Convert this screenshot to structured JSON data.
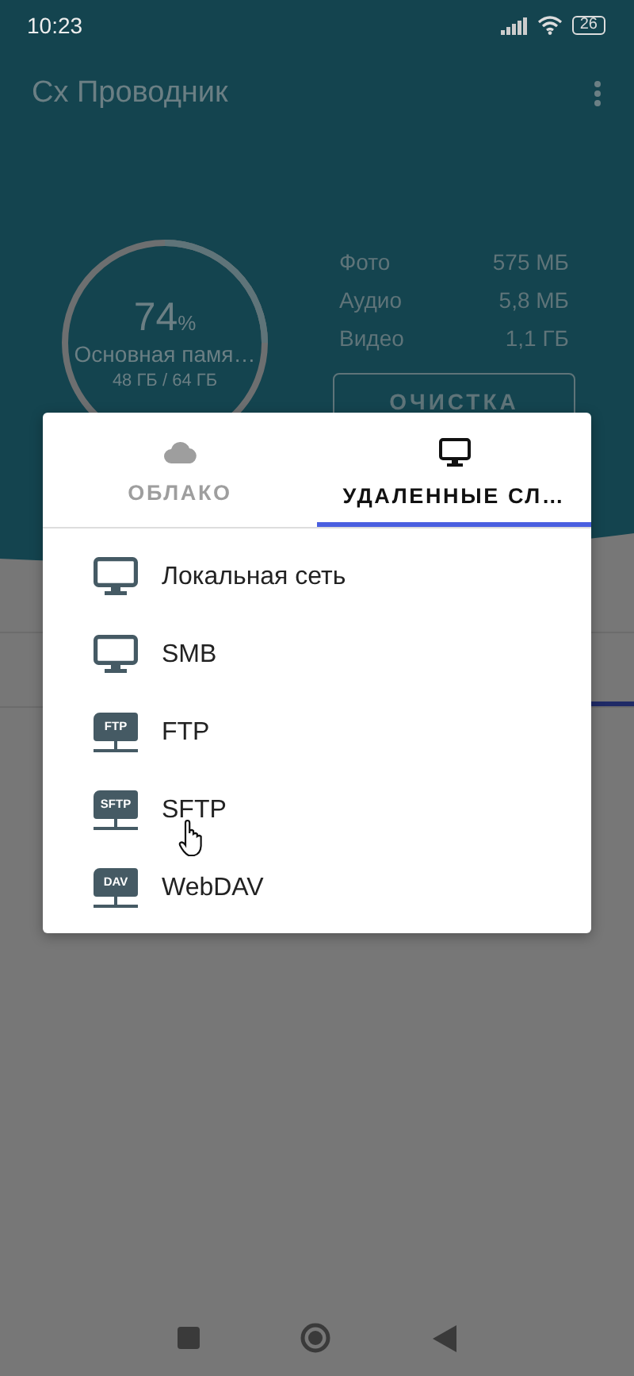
{
  "status_bar": {
    "time": "10:23",
    "battery": "26"
  },
  "app_bar": {
    "title": "Cx Проводник"
  },
  "storage": {
    "percent": "74",
    "percent_sign": "%",
    "label": "Основная памя…",
    "usage": "48 ГБ / 64 ГБ"
  },
  "stats": [
    {
      "label": "Фото",
      "value": "575 МБ"
    },
    {
      "label": "Аудио",
      "value": "5,8 МБ"
    },
    {
      "label": "Видео",
      "value": "1,1 ГБ"
    }
  ],
  "clean_button": "ОЧИСТКА",
  "dialog": {
    "tabs": [
      {
        "label": "ОБЛАКО",
        "kind": "cloud",
        "selected": false
      },
      {
        "label": "УДАЛЕННЫЕ СЛ…",
        "kind": "monitor",
        "selected": true
      }
    ],
    "items": [
      {
        "label": "Локальная сеть",
        "kind": "monitor"
      },
      {
        "label": "SMB",
        "kind": "monitor"
      },
      {
        "label": "FTP",
        "kind": "folder",
        "badge": "FTP"
      },
      {
        "label": "SFTP",
        "kind": "folder",
        "badge": "SFTP"
      },
      {
        "label": "WebDAV",
        "kind": "folder",
        "badge": "DAV"
      }
    ]
  }
}
